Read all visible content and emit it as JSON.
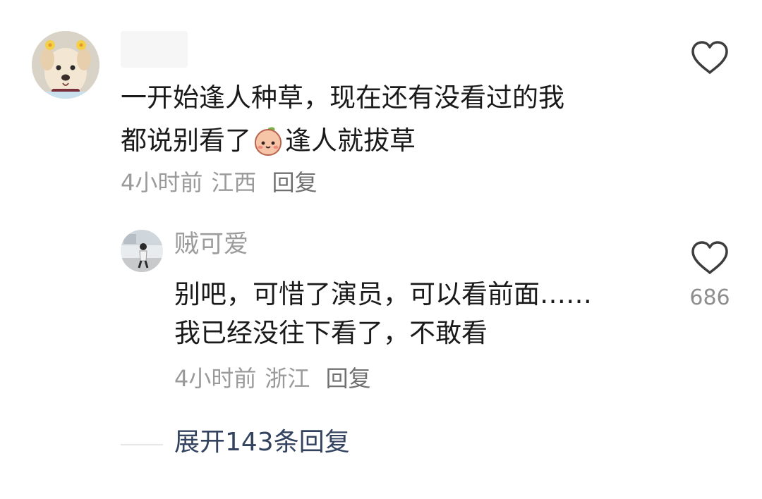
{
  "comments": [
    {
      "username": "",
      "text_line1": "一开始逢人种草，现在还有没看过的我",
      "text_line2_before": "都说别看了",
      "text_line2_emoji": "peach-face-emoji",
      "text_line2_after": "逢人就拔草",
      "time": "4小时前",
      "location": "江西",
      "reply_label": "回复",
      "like_icon": "heart-outline-icon"
    },
    {
      "username": "贼可爱",
      "text_line1": "别吧，可惜了演员，可以看前面……",
      "text_line2": "我已经没往下看了，不敢看",
      "time": "4小时前",
      "location": "浙江",
      "reply_label": "回复",
      "like_icon": "heart-outline-icon",
      "like_count": "686"
    }
  ],
  "expand_replies": {
    "label": "展开143条回复"
  }
}
